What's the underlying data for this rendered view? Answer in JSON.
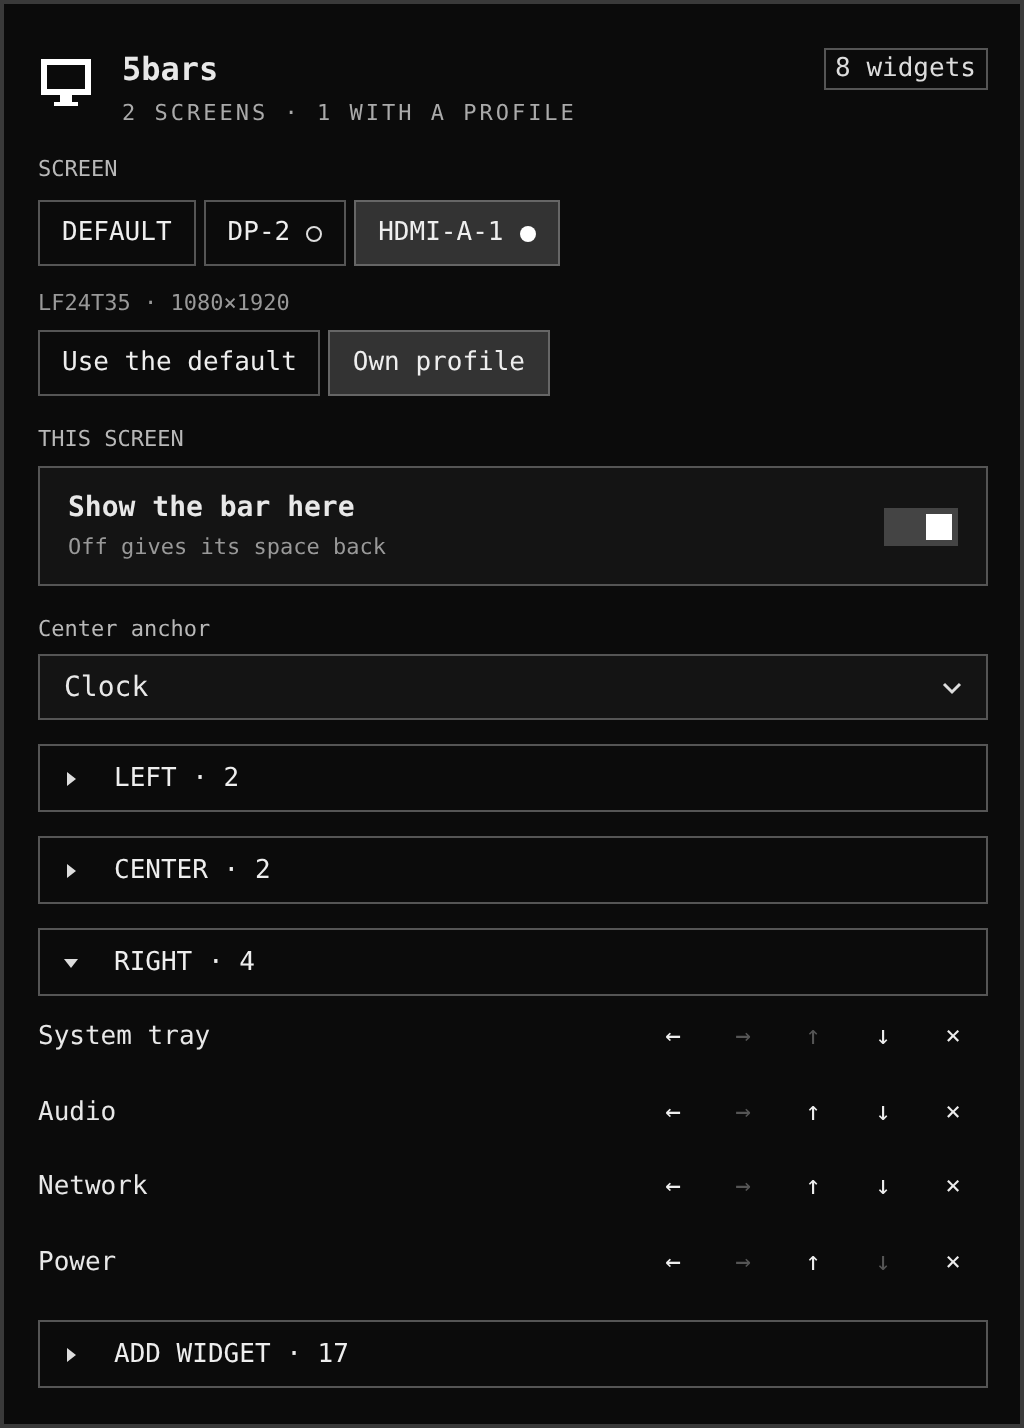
{
  "header": {
    "title": "5bars",
    "subtitle": "2 SCREENS · 1 WITH A PROFILE",
    "badge": "8 widgets"
  },
  "screen_label": "SCREEN",
  "screens": [
    {
      "label": "DEFAULT",
      "selected": false
    },
    {
      "label": "DP-2",
      "selected": false,
      "profile": false
    },
    {
      "label": "HDMI-A-1",
      "selected": true,
      "profile": true
    }
  ],
  "screen_info": "LF24T35 · 1080×1920",
  "profile_options": [
    {
      "label": "Use the default",
      "selected": false
    },
    {
      "label": "Own profile",
      "selected": true
    }
  ],
  "this_screen_label": "THIS SCREEN",
  "show_bar": {
    "title": "Show the bar here",
    "hint": "Off gives its space back",
    "on": true
  },
  "anchor": {
    "label": "Center anchor",
    "value": "Clock"
  },
  "sections": [
    {
      "label": "LEFT · 2",
      "expanded": false
    },
    {
      "label": "CENTER · 2",
      "expanded": false
    },
    {
      "label": "RIGHT · 4",
      "expanded": true
    }
  ],
  "widgets": [
    {
      "name": "System tray",
      "actions": [
        {
          "symbol": "←",
          "disabled": false
        },
        {
          "symbol": "→",
          "disabled": true
        },
        {
          "symbol": "↑",
          "disabled": true
        },
        {
          "symbol": "↓",
          "disabled": false
        },
        {
          "symbol": "×",
          "disabled": false
        }
      ]
    },
    {
      "name": "Audio",
      "actions": [
        {
          "symbol": "←",
          "disabled": false
        },
        {
          "symbol": "→",
          "disabled": true
        },
        {
          "symbol": "↑",
          "disabled": false
        },
        {
          "symbol": "↓",
          "disabled": false
        },
        {
          "symbol": "×",
          "disabled": false
        }
      ]
    },
    {
      "name": "Network",
      "actions": [
        {
          "symbol": "←",
          "disabled": false
        },
        {
          "symbol": "→",
          "disabled": true
        },
        {
          "symbol": "↑",
          "disabled": false
        },
        {
          "symbol": "↓",
          "disabled": false
        },
        {
          "symbol": "×",
          "disabled": false
        }
      ]
    },
    {
      "name": "Power",
      "actions": [
        {
          "symbol": "←",
          "disabled": false
        },
        {
          "symbol": "→",
          "disabled": true
        },
        {
          "symbol": "↑",
          "disabled": false
        },
        {
          "symbol": "↓",
          "disabled": true
        },
        {
          "symbol": "×",
          "disabled": false
        }
      ]
    }
  ],
  "add_widget": {
    "label": "ADD WIDGET · 17",
    "expanded": false
  }
}
